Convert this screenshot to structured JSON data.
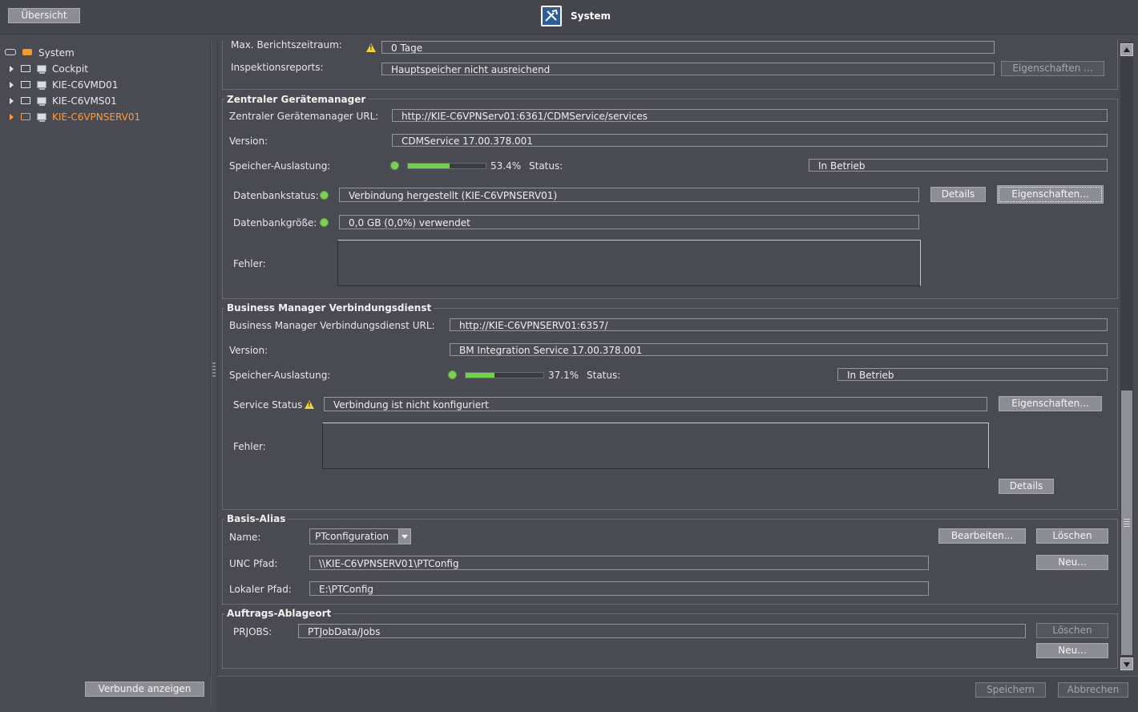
{
  "header": {
    "overview_button": "Übersicht",
    "title": "System"
  },
  "tree": {
    "root": "System",
    "items": [
      {
        "label": "Cockpit",
        "selected": false
      },
      {
        "label": "KIE-C6VMD01",
        "selected": false
      },
      {
        "label": "KIE-C6VMS01",
        "selected": false
      },
      {
        "label": "KIE-C6VPNSERV01",
        "selected": true
      }
    ],
    "show_groups_button": "Verbunde anzeigen"
  },
  "top_section": {
    "report_period_label": "Max. Berichtszeitraum:",
    "report_period_value": "0 Tage",
    "inspection_label": "Inspektionsreports:",
    "inspection_value": "Hauptspeicher nicht ausreichend",
    "properties_button": "Eigenschaften ..."
  },
  "cdm": {
    "title": "Zentraler Gerätemanager",
    "url_label": "Zentraler Gerätemanager URL:",
    "url_value": "http://KIE-C6VPNServ01:6361/CDMService/services",
    "version_label": "Version:",
    "version_value": "CDMService 17.00.378.001",
    "memory_label": "Speicher-Auslastung:",
    "memory_percent_text": "53.4%",
    "memory_fraction": 0.534,
    "status_label": "Status:",
    "status_value": "In Betrieb",
    "db_status_label": "Datenbankstatus:",
    "db_status_value": "Verbindung hergestellt (KIE-C6VPNSERV01)",
    "details_button": "Details",
    "properties_button": "Eigenschaften...",
    "db_size_label": "Datenbankgröße:",
    "db_size_value": "0,0 GB (0,0%) verwendet",
    "error_label": "Fehler:",
    "status_color": "#7fce5c"
  },
  "bmc": {
    "title": "Business Manager Verbindungsdienst",
    "url_label": "Business Manager Verbindungsdienst URL:",
    "url_value": "http://KIE-C6VPNSERV01:6357/",
    "version_label": "Version:",
    "version_value": "BM Integration Service 17.00.378.001",
    "memory_label": "Speicher-Auslastung:",
    "memory_percent_text": "37.1%",
    "memory_fraction": 0.371,
    "status_label": "Status:",
    "status_value": "In Betrieb",
    "service_status_label": "Service Status",
    "service_status_value": "Verbindung ist nicht konfiguriert",
    "properties_button": "Eigenschaften...",
    "error_label": "Fehler:",
    "details_button": "Details"
  },
  "alias": {
    "title": "Basis-Alias",
    "name_label": "Name:",
    "name_value": "PTconfiguration",
    "edit_button": "Bearbeiten...",
    "delete_button": "Löschen",
    "unc_label": "UNC Pfad:",
    "unc_value": "\\\\KIE-C6VPNSERV01\\PTConfig",
    "new_button": "Neu...",
    "local_label": "Lokaler Pfad:",
    "local_value": "E:\\PTConfig"
  },
  "jobs": {
    "title": "Auftrags-Ablageort",
    "prjobs_label": "PRJOBS:",
    "prjobs_value": "PTJobData/Jobs",
    "delete_button": "Löschen",
    "new_button": "Neu..."
  },
  "footer": {
    "save_button": "Speichern",
    "cancel_button": "Abbrechen"
  },
  "icons": [
    "system-icon",
    "tree-expand-icon",
    "folder-icon",
    "computer-icon",
    "warning-icon",
    "status-ok-icon",
    "dropdown-arrow-icon",
    "scroll-up-icon",
    "scroll-down-icon"
  ]
}
